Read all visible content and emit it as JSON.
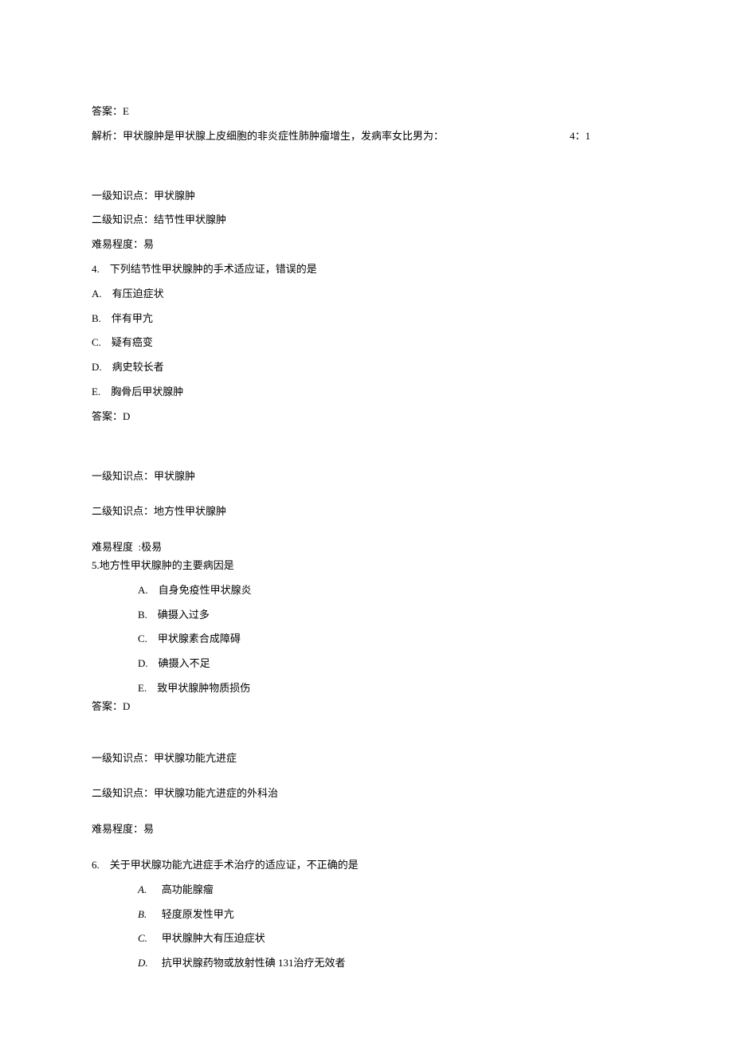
{
  "pre": {
    "answer_line": "答案：E",
    "explain_left": "解析：甲状腺肿是甲状腺上皮细胞的非炎症性肺肿瘤增生，发病率女比男为：",
    "explain_right": "4：1"
  },
  "q4": {
    "kp1": "一级知识点：甲状腺肿",
    "kp2": "二级知识点：结节性甲状腺肿",
    "difficulty": "难易程度：易",
    "stem_num": "4.",
    "stem_text": "下列结节性甲状腺肿的手术适应证，错误的是",
    "options": {
      "A": {
        "label": "A.",
        "text": "有压迫症状"
      },
      "B": {
        "label": "B.",
        "text": "伴有甲亢"
      },
      "C": {
        "label": "C.",
        "text": "疑有癌变"
      },
      "D": {
        "label": "D.",
        "text": "病史较长者"
      },
      "E": {
        "label": "E.",
        "text": "胸骨后甲状腺肿"
      }
    },
    "answer": "答案：D"
  },
  "q5": {
    "kp1": "一级知识点：甲状腺肿",
    "kp2": "二级知识点：地方性甲状腺肿",
    "difficulty_label": "难易程度",
    "difficulty_value": ":极易",
    "stem": "5.地方性甲状腺肿的主要病因是",
    "options": {
      "A": {
        "label": "A.",
        "text": "自身免疫性甲状腺炎"
      },
      "B": {
        "label": "B.",
        "text": "碘摄入过多"
      },
      "C": {
        "label": "C.",
        "text": "甲状腺素合成障碍"
      },
      "D": {
        "label": "D.",
        "text": "碘摄入不足"
      },
      "E": {
        "label": "E.",
        "text": "致甲状腺肿物质损伤"
      }
    },
    "answer": "答案：D"
  },
  "q6": {
    "kp1": "一级知识点：甲状腺功能亢进症",
    "kp2": "二级知识点：甲状腺功能亢进症的外科治",
    "difficulty": "难易程度：易",
    "stem_num": "6.",
    "stem_text": "关于甲状腺功能亢进症手术治疗的适应证，不正确的是",
    "options": {
      "A": {
        "label": "A.",
        "text": "高功能腺瘤"
      },
      "B": {
        "label": "B.",
        "text": "轻度原发性甲亢"
      },
      "C": {
        "label": "C.",
        "text": "甲状腺肿大有压迫症状"
      },
      "D": {
        "label": "D.",
        "text": "抗甲状腺药物或放射性碘 131治疗无效者"
      }
    }
  }
}
